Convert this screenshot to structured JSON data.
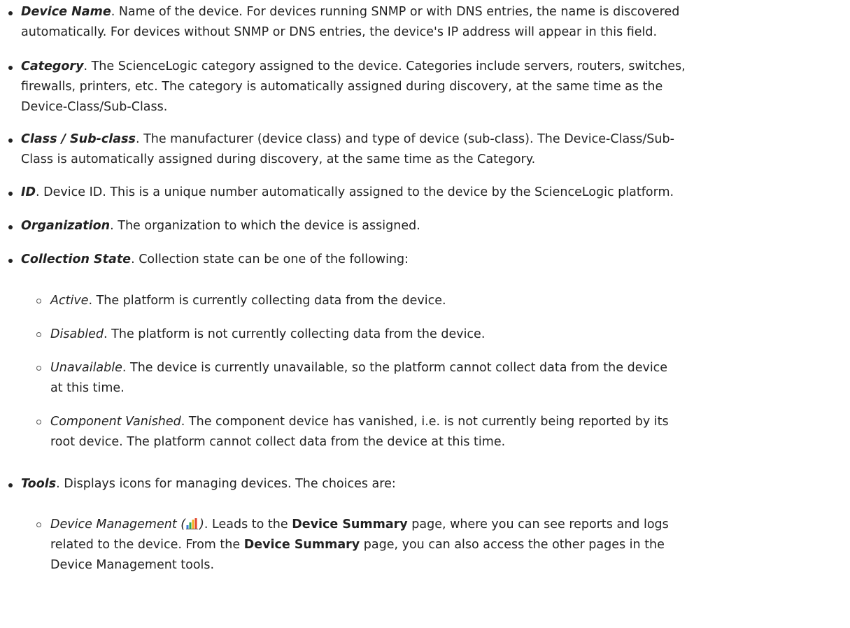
{
  "bullets": [
    {
      "term": "Device Name",
      "lines": [
        ". Name of the device. For devices running SNMP or with DNS entries, the name is discovered",
        "automatically. For devices without SNMP or DNS entries, the device's IP address will appear in this field."
      ]
    },
    {
      "term": "Category",
      "lines": [
        ". The ScienceLogic category assigned to the device. Categories include servers, routers, switches,",
        "firewalls, printers, etc. The category is automatically assigned during discovery, at the same time as the",
        "Device-Class/Sub-Class."
      ]
    },
    {
      "term": "Class / Sub-class",
      "lines": [
        ". The manufacturer (device class) and type of device (sub-class). The Device-Class/Sub-",
        "Class is automatically assigned during discovery, at the same time as the Category."
      ]
    },
    {
      "term": "ID",
      "lines": [
        ". Device ID. This is a unique number automatically assigned to the device by the ScienceLogic platform."
      ]
    },
    {
      "term": "Organization",
      "lines": [
        ". The organization to which the device is assigned."
      ]
    },
    {
      "term": "Collection State",
      "lines": [
        ". Collection state can be one of the following:"
      ]
    }
  ],
  "collection_states": [
    {
      "term": "Active",
      "lines": [
        ". The platform is currently collecting data from the device."
      ]
    },
    {
      "term": "Disabled",
      "lines": [
        ". The platform is not currently collecting data from the device."
      ]
    },
    {
      "term": "Unavailable",
      "lines": [
        ". The device is currently unavailable, so the platform cannot collect data from the device",
        "at this time."
      ]
    },
    {
      "term": "Component Vanished",
      "lines": [
        ". The component device has vanished, i.e. is not currently being reported by its",
        "root device. The platform cannot collect data from the device at this time."
      ]
    }
  ],
  "tools": {
    "term": "Tools",
    "text": ". Displays icons for managing devices. The choices are:"
  },
  "device_management": {
    "term_open": "Device Management (",
    "icon": "bar-chart-icon",
    "term_close": ")",
    "text_a": ". Leads to the ",
    "bold_a": "Device Summary",
    "text_b": " page, where you can see reports and logs",
    "line2_a": "related to the device. From the ",
    "line2_bold": "Device Summary",
    "line2_b": " page, you can also access the other pages in the",
    "line3": "Device Management tools."
  }
}
